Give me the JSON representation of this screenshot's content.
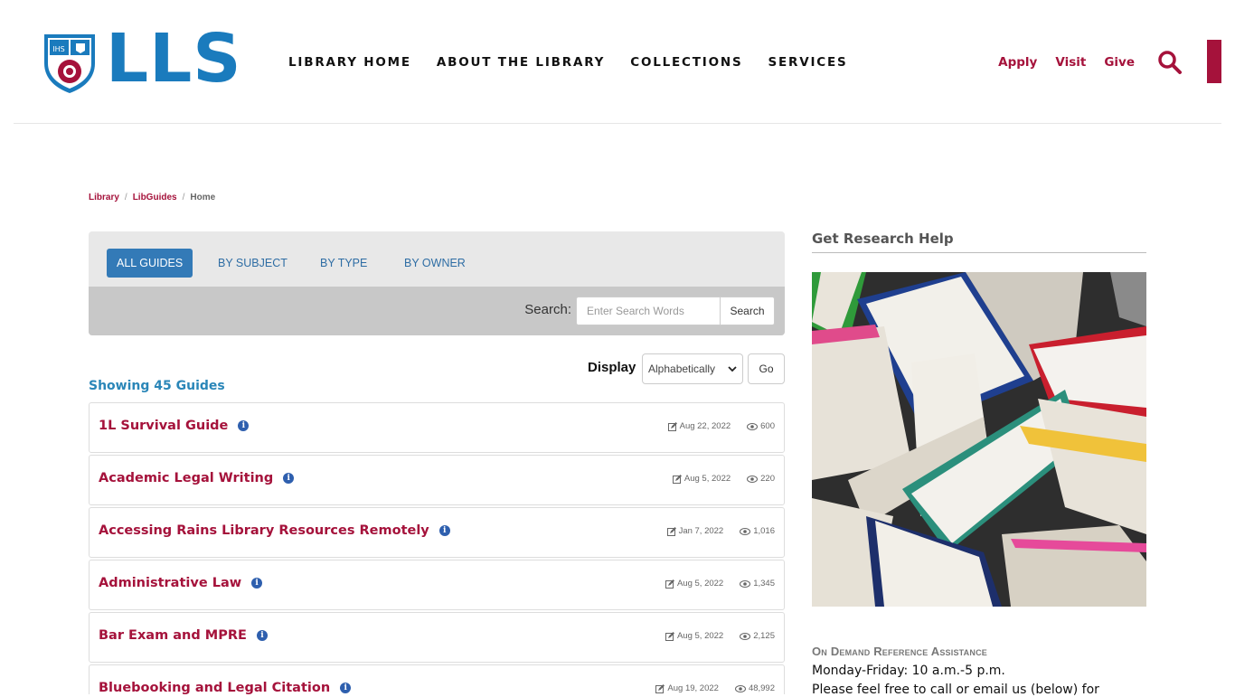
{
  "header": {
    "logo_text": "LLS",
    "nav": [
      "LIBRARY HOME",
      "ABOUT THE LIBRARY",
      "COLLECTIONS",
      "SERVICES"
    ],
    "util": [
      "Apply",
      "Visit",
      "Give"
    ],
    "accent": "#a5123b",
    "brand_blue": "#1a7bbd"
  },
  "breadcrumb": [
    "Library",
    "LibGuides",
    "Home"
  ],
  "tabs": [
    "ALL GUIDES",
    "BY SUBJECT",
    "BY TYPE",
    "BY OWNER"
  ],
  "search": {
    "label": "Search:",
    "placeholder": "Enter Search Words",
    "button": "Search"
  },
  "display": {
    "label": "Display",
    "selected": "Alphabetically",
    "go": "Go"
  },
  "showing": "Showing 45 Guides",
  "guides": [
    {
      "title": "1L Survival Guide",
      "date": "Aug 22, 2022",
      "views": "600"
    },
    {
      "title": "Academic Legal Writing",
      "date": "Aug 5, 2022",
      "views": "220"
    },
    {
      "title": "Accessing Rains Library Resources Remotely",
      "date": "Jan 7, 2022",
      "views": "1,016"
    },
    {
      "title": "Administrative Law",
      "date": "Aug 5, 2022",
      "views": "1,345"
    },
    {
      "title": "Bar Exam and MPRE",
      "date": "Aug 5, 2022",
      "views": "2,125"
    },
    {
      "title": "Bluebooking and Legal Citation",
      "date": "Aug 19, 2022",
      "views": "48,992"
    }
  ],
  "sidebar": {
    "title": "Get Research Help",
    "ref_title": "On Demand Reference Assistance",
    "ref_hours": "Monday-Friday: 10 a.m.-5 p.m.",
    "ref_note": "Please feel free to call or email us (below) for"
  }
}
